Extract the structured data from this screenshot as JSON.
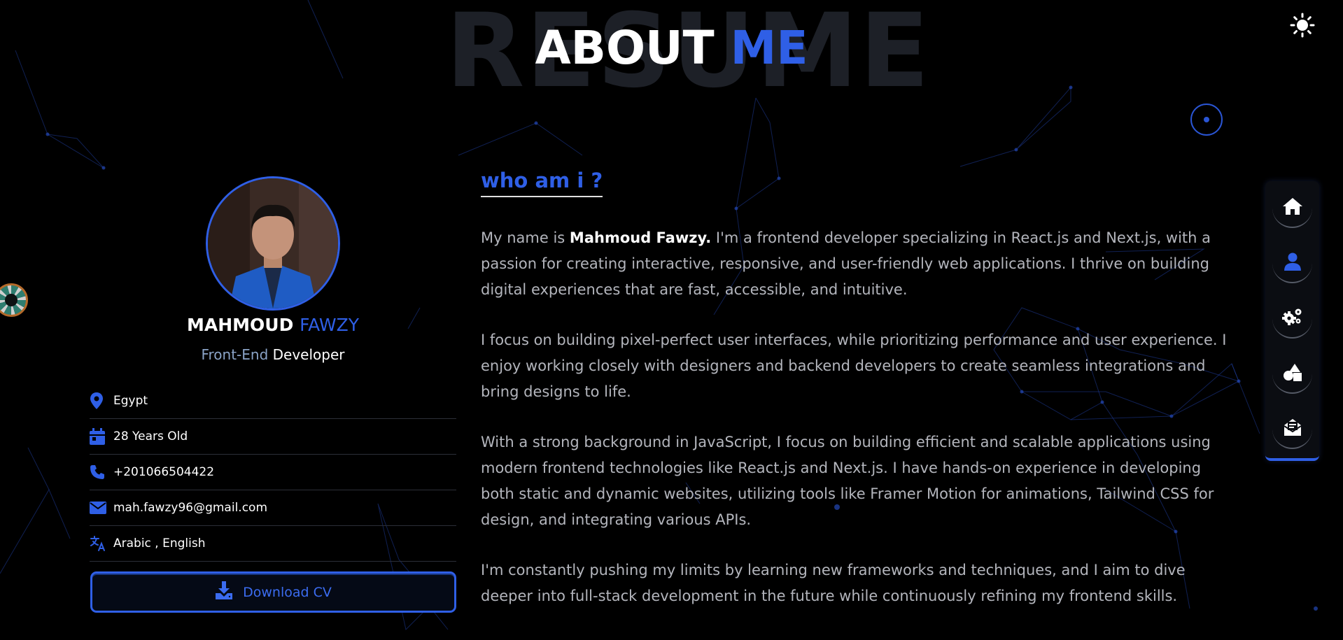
{
  "background_word": "RESUME",
  "section_title": {
    "word1": "ABOUT",
    "word2": "ME"
  },
  "profile": {
    "first_name": "MAHMOUD",
    "last_name": "FAWZY",
    "role_accent": "Front-End",
    "role_rest": "Developer",
    "info": [
      {
        "icon": "location-pin-icon",
        "text": "Egypt"
      },
      {
        "icon": "calendar-icon",
        "text": "28 Years Old"
      },
      {
        "icon": "phone-icon",
        "text": "+201066504422"
      },
      {
        "icon": "envelope-icon",
        "text": "mah.fawzy96@gmail.com"
      },
      {
        "icon": "translate-icon",
        "text": "Arabic , English"
      }
    ],
    "download_label": "Download CV"
  },
  "about": {
    "heading": "who am i ?",
    "p1_pre": "My name is",
    "p1_name": "Mahmoud Fawzy.",
    "p1_post": "I'm a frontend developer specializing in React.js and Next.js, with a passion for creating interactive, responsive, and user-friendly web applications. I thrive on building digital experiences that are fast, accessible, and intuitive.",
    "p2": "I focus on building pixel-perfect user interfaces, while prioritizing performance and user experience. I enjoy working closely with designers and backend developers to create seamless integrations and bring designs to life.",
    "p3": "With a strong background in JavaScript, I focus on building efficient and scalable applications using modern frontend technologies like React.js and Next.js. I have hands-on experience in developing both static and dynamic websites, utilizing tools like Framer Motion for animations, Tailwind CSS for design, and integrating various APIs.",
    "p4": "I'm constantly pushing my limits by learning new frameworks and techniques, and I aim to dive deeper into full-stack development in the future while continuously refining my frontend skills."
  },
  "nav": [
    "home-icon",
    "user-icon",
    "gears-icon",
    "shapes-icon",
    "mail-icon"
  ],
  "colors": {
    "accent": "#2f5fe6",
    "background": "#000000",
    "text_muted": "#b3b5bc"
  }
}
